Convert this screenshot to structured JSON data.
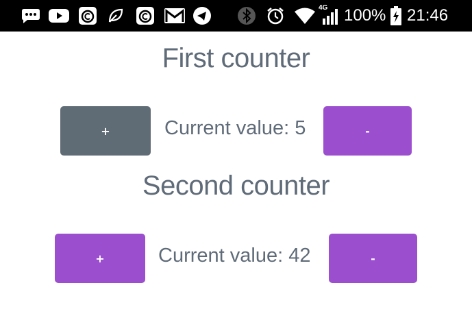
{
  "status_bar": {
    "battery_percent": "100%",
    "time": "21:46",
    "network_label": "4G",
    "icons": [
      "chat-bubble-icon",
      "youtube-icon",
      "app-c-icon",
      "leaf-icon",
      "app-c-icon",
      "gmail-icon",
      "telegram-icon",
      "bluetooth-icon",
      "alarm-icon",
      "wifi-icon",
      "signal-icon",
      "battery-charging-icon"
    ]
  },
  "counters": [
    {
      "title": "First counter",
      "value_text": "Current value: 5",
      "plus_label": "+",
      "minus_label": "-"
    },
    {
      "title": "Second counter",
      "value_text": "Current value: 42",
      "plus_label": "+",
      "minus_label": "-"
    }
  ],
  "colors": {
    "status_bar_bg": "#000000",
    "purple_button": "#9b4fcf",
    "gray_button": "#5f6b75",
    "text": "#5f6b78"
  }
}
